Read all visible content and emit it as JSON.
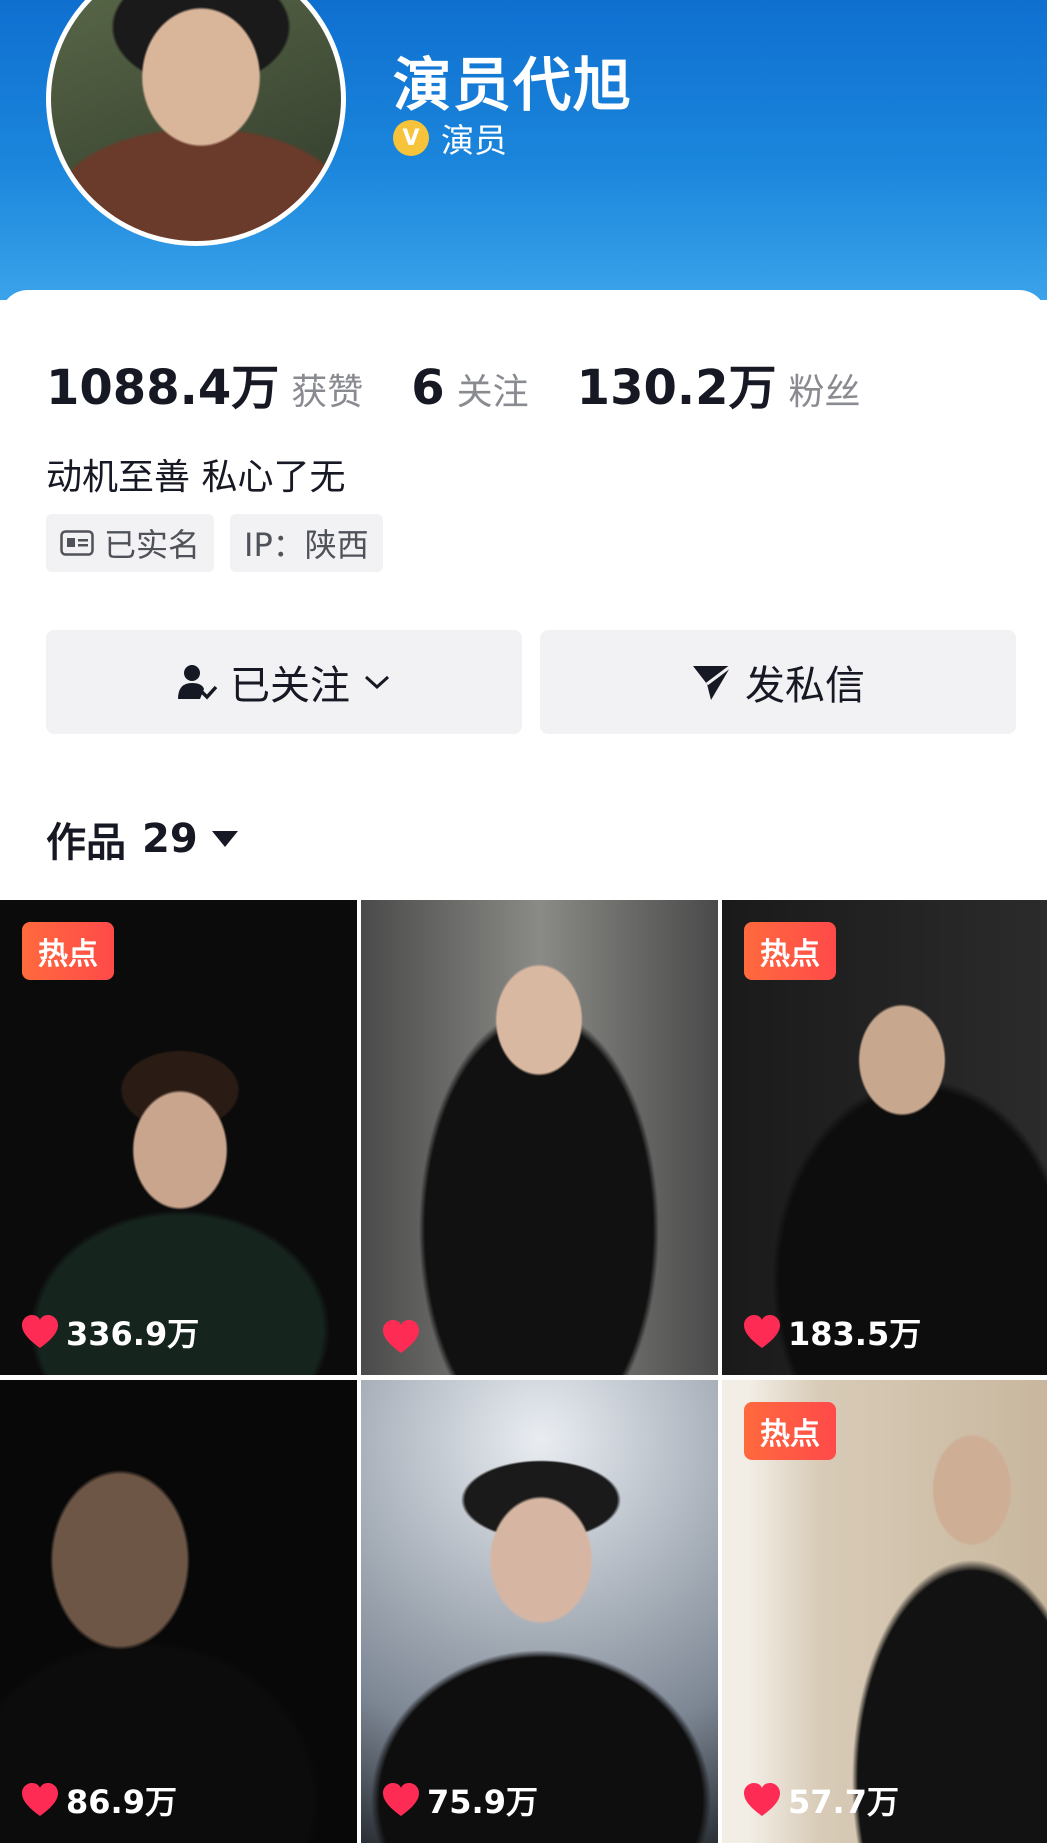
{
  "profile": {
    "name": "演员代旭",
    "verified_badge": "V",
    "verified_label": "演员"
  },
  "stats": [
    {
      "value": "1088.4万",
      "label": "获赞"
    },
    {
      "value": "6",
      "label": "关注"
    },
    {
      "value": "130.2万",
      "label": "粉丝"
    }
  ],
  "bio": "动机至善 私心了无",
  "tags": {
    "realname": "已实名",
    "ip": "IP：陕西"
  },
  "buttons": {
    "follow": "已关注",
    "message": "发私信"
  },
  "works": {
    "label": "作品",
    "count": "29"
  },
  "hot_label": "热点",
  "colors": {
    "header_blue": "#1b86dc",
    "hot_orange": "#ff5a3c",
    "like_red": "#fe2c55"
  },
  "videos": [
    {
      "likes": "336.9万",
      "hot": true
    },
    {
      "likes": "",
      "hot": false
    },
    {
      "likes": "183.5万",
      "hot": true
    },
    {
      "likes": "86.9万",
      "hot": false
    },
    {
      "likes": "75.9万",
      "hot": false
    },
    {
      "likes": "57.7万",
      "hot": true
    }
  ]
}
